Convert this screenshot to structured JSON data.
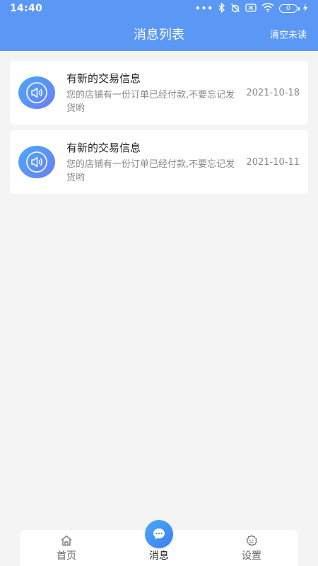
{
  "status_bar": {
    "time": "14:40",
    "battery_level": "0"
  },
  "header": {
    "title": "消息列表",
    "action": "清空未读"
  },
  "messages": [
    {
      "title": "有新的交易信息",
      "text": "您的店铺有一份订单已经付款,不要忘记发货哟",
      "date": "2021-10-18"
    },
    {
      "title": "有新的交易信息",
      "text": "您的店铺有一份订单已经付款,不要忘记发货哟",
      "date": "2021-10-11"
    }
  ],
  "tabbar": {
    "items": [
      {
        "label": "首页",
        "icon": "home-icon"
      },
      {
        "label": "消息",
        "icon": "message-icon"
      },
      {
        "label": "设置",
        "icon": "settings-icon"
      }
    ],
    "active_index": 1
  },
  "colors": {
    "primary": "#5b98f5",
    "background": "#f4f4f4"
  }
}
